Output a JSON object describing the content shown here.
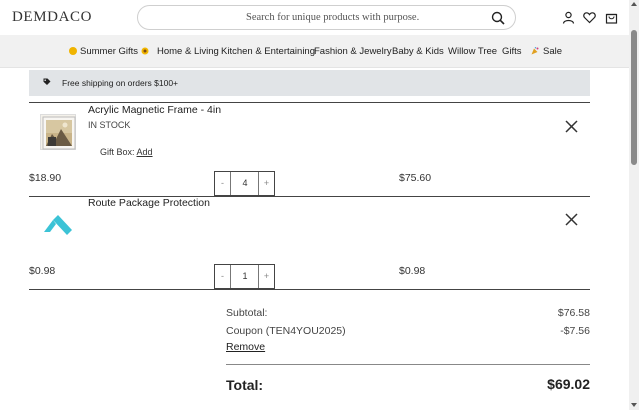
{
  "header": {
    "logo": "DEMDACO",
    "search_placeholder": "Search for unique products with purpose."
  },
  "nav": {
    "items": [
      {
        "label": "Summer Gifts"
      },
      {
        "label": "Home & Living"
      },
      {
        "label": "Kitchen & Entertaining"
      },
      {
        "label": "Fashion & Jewelry"
      },
      {
        "label": "Baby & Kids"
      },
      {
        "label": "Willow Tree"
      },
      {
        "label": "Gifts"
      },
      {
        "label": "Sale"
      }
    ]
  },
  "banner": {
    "text": "Free shipping on orders $100+"
  },
  "cart": {
    "items": [
      {
        "title": "Acrylic Magnetic Frame - 4in",
        "stock": "IN STOCK",
        "gift_box_label": "Gift Box:",
        "gift_box_action": "Add",
        "unit_price": "$18.90",
        "quantity": "4",
        "line_total": "$75.60"
      },
      {
        "title": "Route Package Protection",
        "unit_price": "$0.98",
        "quantity": "1",
        "line_total": "$0.98"
      }
    ]
  },
  "summary": {
    "subtotal_label": "Subtotal:",
    "subtotal_value": "$76.58",
    "coupon_label": "Coupon (TEN4YOU2025)",
    "coupon_value": "-$7.56",
    "coupon_remove": "Remove",
    "total_label": "Total:",
    "total_value": "$69.02"
  },
  "qty_controls": {
    "minus": "-",
    "plus": "+"
  },
  "colors": {
    "route_brand": "#3cc3d6",
    "banner_bg": "#e1e4e7",
    "nav_bg": "#f1f1f1"
  }
}
